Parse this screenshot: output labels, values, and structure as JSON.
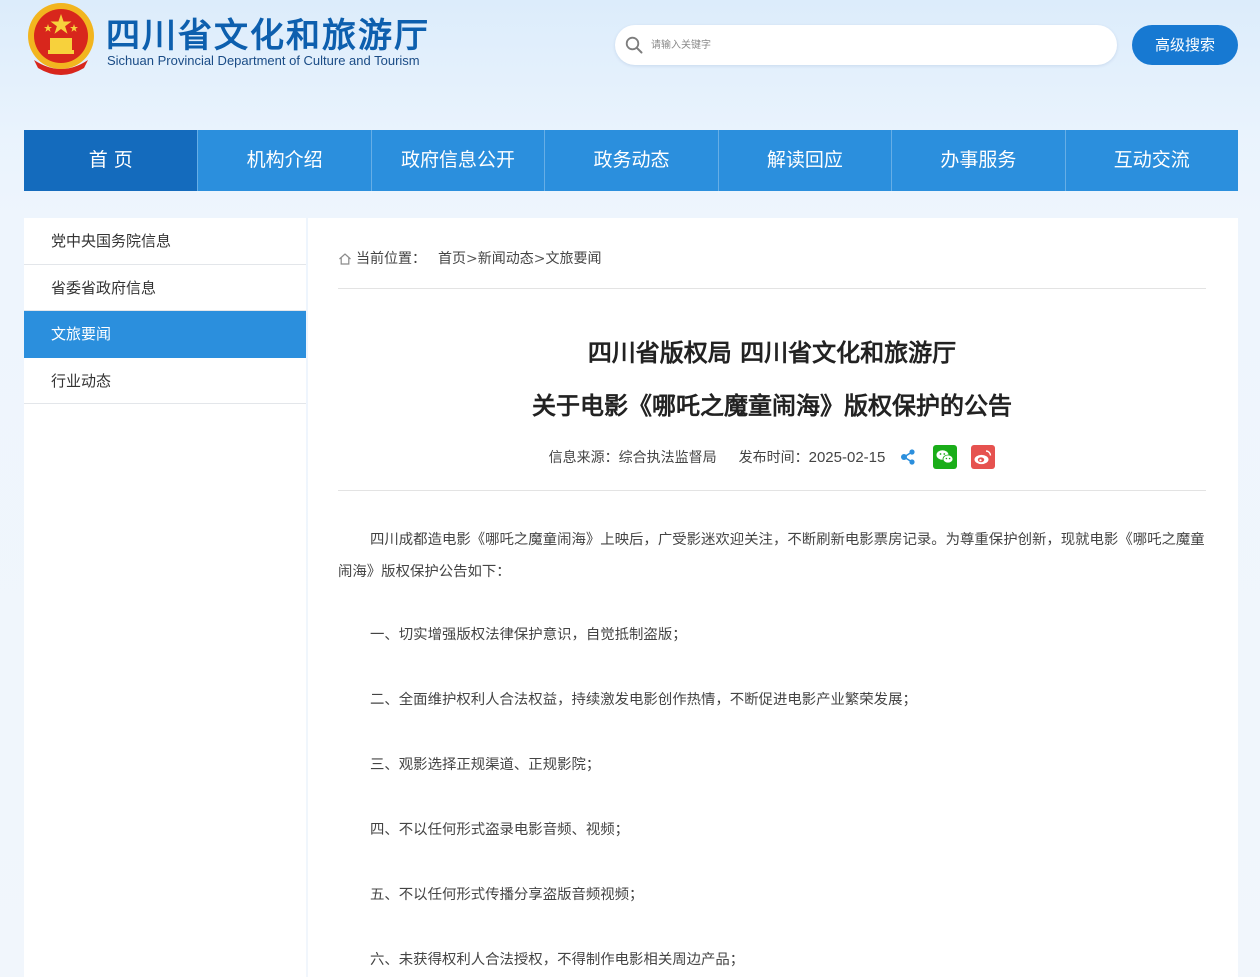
{
  "header": {
    "title_cn": "四川省文化和旅游厅",
    "title_en": "Sichuan Provincial Department of Culture and Tourism",
    "search_placeholder": "请输入关键字",
    "advanced_search_label": "高级搜索"
  },
  "nav": {
    "items": [
      {
        "label": "首 页",
        "active": true
      },
      {
        "label": "机构介绍"
      },
      {
        "label": "政府信息公开"
      },
      {
        "label": "政务动态"
      },
      {
        "label": "解读回应"
      },
      {
        "label": "办事服务"
      },
      {
        "label": "互动交流"
      }
    ]
  },
  "sidebar": {
    "items": [
      {
        "label": "党中央国务院信息"
      },
      {
        "label": "省委省政府信息"
      },
      {
        "label": "文旅要闻",
        "active": true
      },
      {
        "label": "行业动态"
      }
    ]
  },
  "breadcrumb": {
    "label": "当前位置：",
    "items": [
      "首页",
      "新闻动态",
      "文旅要闻"
    ],
    "separator": ">"
  },
  "article": {
    "title_line1": "四川省版权局 四川省文化和旅游厅",
    "title_line2": "关于电影《哪吒之魔童闹海》版权保护的公告",
    "source": "信息来源：综合执法监督局",
    "date_label": "发布时间：",
    "date": "2025-02-15",
    "intro": "四川成都造电影《哪吒之魔童闹海》上映后，广受影迷欢迎关注，不断刷新电影票房记录。为尊重保护创新，现就电影《哪吒之魔童闹海》版权保护公告如下：",
    "items": [
      "一、切实增强版权法律保护意识，自觉抵制盗版；",
      "二、全面维护权利人合法权益，持续激发电影创作热情，不断促进电影产业繁荣发展；",
      "三、观影选择正规渠道、正规影院；",
      "四、不以任何形式盗录电影音频、视频；",
      "五、不以任何形式传播分享盗版音频视频；",
      "六、未获得权利人合法授权，不得制作电影相关周边产品；"
    ]
  },
  "colors": {
    "nav_bg": "#2b8fdd",
    "nav_active": "#146bbd",
    "brand_blue": "#0d5fae",
    "wechat_green": "#1aad19",
    "weibo_red": "#e6524f"
  }
}
